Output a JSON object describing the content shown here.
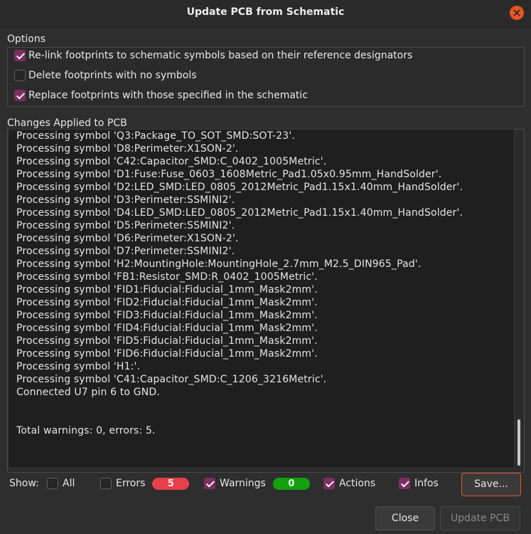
{
  "dialog": {
    "title": "Update PCB from Schematic"
  },
  "options": {
    "label": "Options",
    "items": [
      {
        "label": "Re-link footprints to schematic symbols based on their reference designators",
        "checked": true
      },
      {
        "label": "Delete footprints with no symbols",
        "checked": false
      },
      {
        "label": "Replace footprints with those specified in the schematic",
        "checked": true
      }
    ]
  },
  "changes": {
    "label": "Changes Applied to PCB",
    "lines": [
      "Processing symbol 'Q3:Package_TO_SOT_SMD:SOT-23'.",
      "Processing symbol 'D8:Perimeter:X1SON-2'.",
      "Processing symbol 'C42:Capacitor_SMD:C_0402_1005Metric'.",
      "Processing symbol 'D1:Fuse:Fuse_0603_1608Metric_Pad1.05x0.95mm_HandSolder'.",
      "Processing symbol 'D2:LED_SMD:LED_0805_2012Metric_Pad1.15x1.40mm_HandSolder'.",
      "Processing symbol 'D3:Perimeter:SSMINI2'.",
      "Processing symbol 'D4:LED_SMD:LED_0805_2012Metric_Pad1.15x1.40mm_HandSolder'.",
      "Processing symbol 'D5:Perimeter:SSMINI2'.",
      "Processing symbol 'D6:Perimeter:X1SON-2'.",
      "Processing symbol 'D7:Perimeter:SSMINI2'.",
      "Processing symbol 'H2:MountingHole:MountingHole_2.7mm_M2.5_DIN965_Pad'.",
      "Processing symbol 'FB1:Resistor_SMD:R_0402_1005Metric'.",
      "Processing symbol 'FID1:Fiducial:Fiducial_1mm_Mask2mm'.",
      "Processing symbol 'FID2:Fiducial:Fiducial_1mm_Mask2mm'.",
      "Processing symbol 'FID3:Fiducial:Fiducial_1mm_Mask2mm'.",
      "Processing symbol 'FID4:Fiducial:Fiducial_1mm_Mask2mm'.",
      "Processing symbol 'FID5:Fiducial:Fiducial_1mm_Mask2mm'.",
      "Processing symbol 'FID6:Fiducial:Fiducial_1mm_Mask2mm'.",
      "Processing symbol 'H1:'.",
      "Processing symbol 'C41:Capacitor_SMD:C_1206_3216Metric'.",
      "Connected U7 pin 6 to GND.",
      "",
      "",
      "Total warnings: 0, errors: 5."
    ]
  },
  "filters": {
    "show_label": "Show:",
    "all": {
      "label": "All",
      "checked": false
    },
    "errors": {
      "label": "Errors",
      "checked": false,
      "count": "5"
    },
    "warnings": {
      "label": "Warnings",
      "checked": true,
      "count": "0"
    },
    "actions": {
      "label": "Actions",
      "checked": true
    },
    "infos": {
      "label": "Infos",
      "checked": true
    }
  },
  "buttons": {
    "save": "Save...",
    "close": "Close",
    "update": "Update PCB"
  },
  "colors": {
    "accent": "#e95420",
    "checkbox_on": "#7b2e62",
    "error_pill": "#e8404a",
    "warning_pill": "#13a10e"
  },
  "icons": {
    "close": "close-icon"
  }
}
